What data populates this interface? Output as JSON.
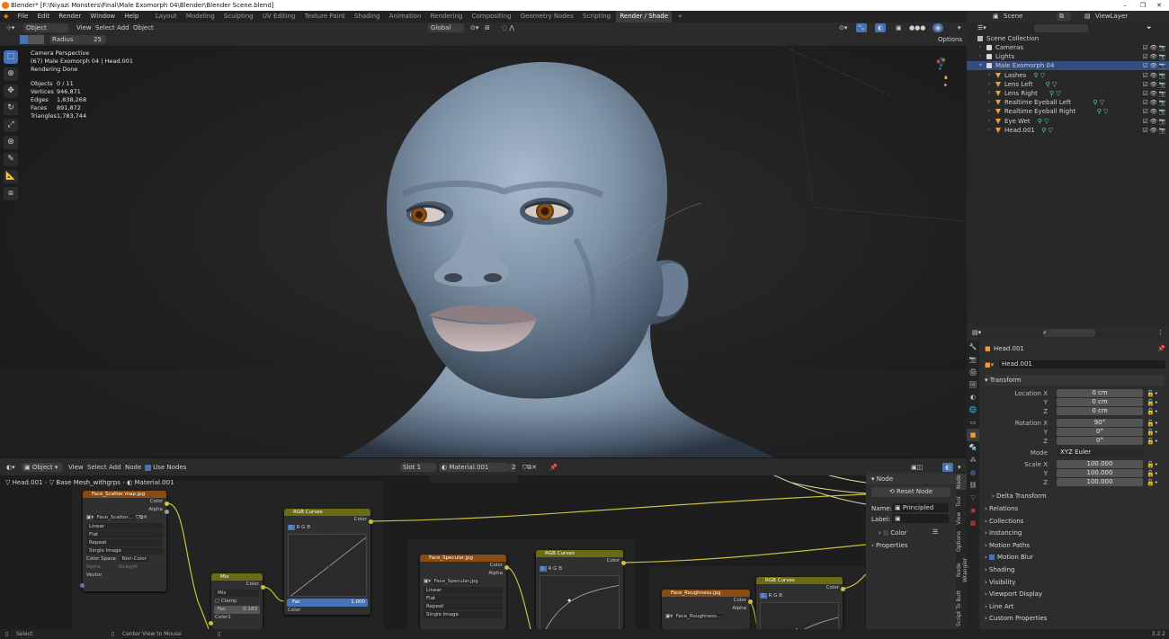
{
  "window": {
    "title": "Blender* [F:\\Niyazi Monsters\\Final\\Male Exomorph 04\\Blender\\Blender Scene.blend]",
    "controls": [
      "–",
      "❐",
      "✕"
    ]
  },
  "menu": {
    "items": [
      "File",
      "Edit",
      "Render",
      "Window",
      "Help"
    ],
    "workspaces": [
      "Layout",
      "Modeling",
      "Sculpting",
      "UV Editing",
      "Texture Paint",
      "Shading",
      "Animation",
      "Rendering",
      "Compositing",
      "Geometry Nodes",
      "Scripting",
      "Render / Shade"
    ],
    "active_workspace": "Render / Shade",
    "add_tab": "+",
    "scene": "Scene",
    "view_layer": "ViewLayer"
  },
  "viewport_header": {
    "mode": "Object Mode",
    "menus": [
      "View",
      "Select",
      "Add",
      "Object"
    ],
    "transform_orientation": "Global",
    "options": "Options",
    "radius_label": "Radius",
    "radius_value": "25"
  },
  "viewport_overlay": {
    "lines": [
      "Camera Perspective",
      "(67) Male Exomorph 04 | Head.001",
      "Rendering Done"
    ],
    "stats": [
      {
        "key": "Objects",
        "value": "0 / 11"
      },
      {
        "key": "Vertices",
        "value": "946,871"
      },
      {
        "key": "Edges",
        "value": "1,838,268"
      },
      {
        "key": "Faces",
        "value": "891,872"
      },
      {
        "key": "Triangles",
        "value": "1,783,744"
      }
    ]
  },
  "toolbar": {
    "tools": [
      "select-box",
      "cursor",
      "move",
      "rotate",
      "scale",
      "transform",
      "annotate",
      "measure",
      "add-cube"
    ]
  },
  "outliner": {
    "search_placeholder": "",
    "root": "Scene Collection",
    "rows": [
      {
        "label": "Cameras",
        "indent": 1,
        "icon": "collection-icon",
        "selected": false
      },
      {
        "label": "Lights",
        "indent": 1,
        "icon": "collection-icon",
        "selected": false
      },
      {
        "label": "Male Exomorph 04",
        "indent": 1,
        "icon": "collection-icon",
        "selected": true
      },
      {
        "label": "Lashes",
        "indent": 2,
        "icon": "mesh-icon",
        "selected": false
      },
      {
        "label": "Lens Left",
        "indent": 2,
        "icon": "mesh-icon",
        "selected": false
      },
      {
        "label": "Lens Right",
        "indent": 2,
        "icon": "mesh-icon",
        "selected": false
      },
      {
        "label": "Realtime Eyeball Left",
        "indent": 2,
        "icon": "mesh-icon",
        "selected": false
      },
      {
        "label": "Realtime Eyeball Right",
        "indent": 2,
        "icon": "mesh-icon",
        "selected": false
      },
      {
        "label": "Eye Wet",
        "indent": 2,
        "icon": "mesh-icon",
        "selected": false
      },
      {
        "label": "Head.001",
        "indent": 2,
        "icon": "mesh-icon",
        "selected": false
      }
    ]
  },
  "properties": {
    "object_name": "Head.001",
    "object_field": "Head.001",
    "transform_label": "Transform",
    "location": {
      "label": "Location X",
      "x": "0 cm",
      "y": "0 cm",
      "z": "0 cm"
    },
    "rotation": {
      "label": "Rotation X",
      "x": "90°",
      "y": "0°",
      "z": "0°"
    },
    "mode": {
      "label": "Mode",
      "value": "XYZ Euler"
    },
    "scale": {
      "label": "Scale X",
      "x": "100.000",
      "y": "100.000",
      "z": "100.000"
    },
    "axis_y": "Y",
    "axis_z": "Z",
    "delta": "Delta Transform",
    "sections": [
      "Relations",
      "Collections",
      "Instancing",
      "Motion Paths",
      "Motion Blur",
      "Shading",
      "Visibility",
      "Viewport Display",
      "Line Art",
      "Custom Properties"
    ]
  },
  "node_editor": {
    "editor_type": "Object",
    "menus": [
      "View",
      "Select",
      "Add",
      "Node"
    ],
    "use_nodes": "Use Nodes",
    "slot": "Slot 1",
    "material": "Material.001",
    "users": "2",
    "breadcrumb": [
      "Head.001",
      "Base Mesh_withgrps",
      "Material.001"
    ],
    "nodes": {
      "scatter": {
        "title": "Face_Scatter map.jpg",
        "out1": "Color",
        "out2": "Alpha",
        "image": "Face_Scatter...",
        "interp": "Linear",
        "proj": "Flat",
        "ext": "Repeat",
        "source": "Single Image",
        "cs_label": "Color Space",
        "cs_value": "Non-Color",
        "alpha_label": "Alpha",
        "alpha_value": "Straight",
        "input": "Vector"
      },
      "mix": {
        "title": "Mix",
        "out": "Color",
        "mode": "Mix",
        "clamp": "Clamp",
        "fac": "Fac",
        "fac_value": "0.183",
        "color1": "Color1"
      },
      "curves1": {
        "title": "RGB Curves",
        "out": "Color",
        "fac": "Fac",
        "fac_value": "1.000",
        "in": "Color",
        "channels": [
          "C",
          "R",
          "G",
          "B"
        ]
      },
      "specular": {
        "title": "Face_Specular.jpg",
        "out1": "Color",
        "out2": "Alpha",
        "image": "Face_Specular.jpg",
        "interp": "Linear",
        "proj": "Flat",
        "ext": "Repeat",
        "source": "Single Image"
      },
      "curves2": {
        "title": "RGB Curves",
        "out": "Color",
        "channels": [
          "C",
          "R",
          "G",
          "B"
        ]
      },
      "roughness": {
        "title": "Face_Roughness.jpg",
        "out1": "Color",
        "out2": "Alpha",
        "image": "Face_Roughness..."
      },
      "curves3": {
        "title": "RGB Curves",
        "out": "Color",
        "channels": [
          "C",
          "R",
          "G",
          "B"
        ]
      }
    }
  },
  "node_panel": {
    "header": "Node",
    "reset": "Reset Node",
    "name_label": "Name:",
    "name_value": "Principled BSDF",
    "label_label": "Label:",
    "color": "Color",
    "properties": "Properties",
    "tabs": [
      "Node",
      "Tool",
      "View",
      "Options",
      "Node Wrangler",
      "Script To Butt"
    ]
  },
  "statusbar": {
    "left": "Select",
    "middle": "Center View to Mouse",
    "version": "3.2.2"
  },
  "colors": {
    "accent": "#4772b3",
    "image_node": "#8a4b12",
    "curves_node": "#6b6b16",
    "skin": "#7f93a8"
  }
}
